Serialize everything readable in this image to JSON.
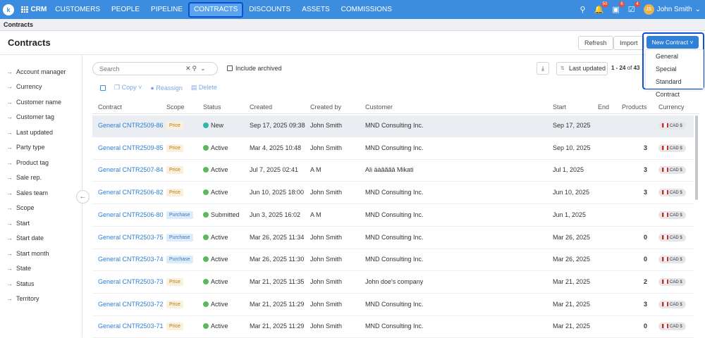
{
  "nav": {
    "logo": "k",
    "app": "CRM",
    "items": [
      "CUSTOMERS",
      "PEOPLE",
      "PIPELINE",
      "CONTRACTS",
      "DISCOUNTS",
      "ASSETS",
      "COMMISSIONS"
    ],
    "badges": {
      "notifications": "50",
      "gifts": "6",
      "tasks": "4"
    },
    "avatar_initials": "JS",
    "user": "John Smith"
  },
  "breadcrumb": "Contracts",
  "page_title": "Contracts",
  "buttons": {
    "refresh": "Refresh",
    "import": "Import",
    "new_contract": "New Contract"
  },
  "new_contract_menu": [
    "General",
    "Special",
    "Standard Contract"
  ],
  "filters": [
    "Account manager",
    "Currency",
    "Customer name",
    "Customer tag",
    "Last updated",
    "Party type",
    "Product tag",
    "Sale rep.",
    "Sales team",
    "Scope",
    "Start",
    "Start date",
    "Start month",
    "State",
    "Status",
    "Territory"
  ],
  "search": {
    "placeholder": "Search"
  },
  "include_archived": "Include archived",
  "sort": {
    "label": "Last updated"
  },
  "pager": {
    "range": "1 - 24",
    "of": "of",
    "total": "43"
  },
  "actions": {
    "copy": "Copy",
    "reassign": "Reassign",
    "delete": "Delete"
  },
  "columns": [
    "Contract",
    "Scope",
    "Status",
    "Created",
    "Created by",
    "Customer",
    "Start",
    "End",
    "Products",
    "Currency"
  ],
  "colors": {
    "active": "#5cb85c",
    "new": "#2fb7a5",
    "submitted": "#5cb85c",
    "link": "#2f7fd6",
    "primary": "#2f80d9"
  },
  "rows": [
    {
      "contract": "General CNTR2509-86",
      "scope": "Price",
      "status": "New",
      "created": "Sep 17, 2025 09:38",
      "created_by": "John Smith",
      "customer": "MND Consulting Inc.",
      "start": "Sep 17, 2025",
      "end": "",
      "products": "",
      "currency": "CAD $"
    },
    {
      "contract": "General CNTR2509-85",
      "scope": "Price",
      "status": "Active",
      "created": "Mar 4, 2025 10:48",
      "created_by": "John Smith",
      "customer": "MND Consulting Inc.",
      "start": "Sep 10, 2025",
      "end": "",
      "products": "3",
      "currency": "CAD $"
    },
    {
      "contract": "General CNTR2507-84",
      "scope": "Price",
      "status": "Active",
      "created": "Jul 7, 2025 02:41",
      "created_by": "A M",
      "customer": "Ali äàâããâ Mikati",
      "start": "Jul 1, 2025",
      "end": "",
      "products": "3",
      "currency": "CAD $"
    },
    {
      "contract": "General CNTR2506-82",
      "scope": "Price",
      "status": "Active",
      "created": "Jun 10, 2025 18:00",
      "created_by": "John Smith",
      "customer": "MND Consulting Inc.",
      "start": "Jun 10, 2025",
      "end": "",
      "products": "3",
      "currency": "CAD $"
    },
    {
      "contract": "General CNTR2506-80",
      "scope": "Purchase",
      "status": "Submitted",
      "created": "Jun 3, 2025 16:02",
      "created_by": "A M",
      "customer": "MND Consulting Inc.",
      "start": "Jun 1, 2025",
      "end": "",
      "products": "",
      "currency": "CAD $"
    },
    {
      "contract": "General CNTR2503-75",
      "scope": "Purchase",
      "status": "Active",
      "created": "Mar 26, 2025 11:34",
      "created_by": "John Smith",
      "customer": "MND Consulting Inc.",
      "start": "Mar 26, 2025",
      "end": "",
      "products": "0",
      "currency": "CAD $"
    },
    {
      "contract": "General CNTR2503-74",
      "scope": "Purchase",
      "status": "Active",
      "created": "Mar 26, 2025 11:30",
      "created_by": "John Smith",
      "customer": "MND Consulting Inc.",
      "start": "Mar 26, 2025",
      "end": "",
      "products": "0",
      "currency": "CAD $"
    },
    {
      "contract": "General CNTR2503-73",
      "scope": "Price",
      "status": "Active",
      "created": "Mar 21, 2025 11:35",
      "created_by": "John Smith",
      "customer": "John doe's company",
      "start": "Mar 21, 2025",
      "end": "",
      "products": "2",
      "currency": "CAD $"
    },
    {
      "contract": "General CNTR2503-72",
      "scope": "Price",
      "status": "Active",
      "created": "Mar 21, 2025 11:29",
      "created_by": "John Smith",
      "customer": "MND Consulting Inc.",
      "start": "Mar 21, 2025",
      "end": "",
      "products": "3",
      "currency": "CAD $"
    },
    {
      "contract": "General CNTR2503-71",
      "scope": "Price",
      "status": "Active",
      "created": "Mar 21, 2025 11:29",
      "created_by": "John Smith",
      "customer": "MND Consulting Inc.",
      "start": "Mar 21, 2025",
      "end": "",
      "products": "0",
      "currency": "CAD $"
    }
  ]
}
